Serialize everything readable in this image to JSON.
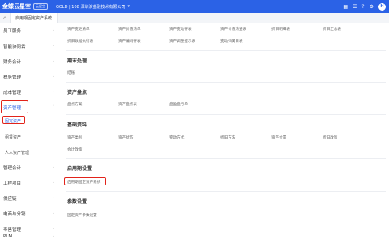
{
  "topbar": {
    "logo": "金蝶云星空",
    "logo_tag": "云星空",
    "org": "GOLD | 108 深圳演金融技术有限公司",
    "user_initial": "H"
  },
  "tabs": {
    "home_icon": "home-icon",
    "active": "启用期固定资产系统"
  },
  "sidebar": {
    "items": [
      {
        "label": "员工服务"
      },
      {
        "label": "智能协同云"
      },
      {
        "label": "财务会计"
      },
      {
        "label": "税务管理"
      },
      {
        "label": "成本管理"
      },
      {
        "label": "资产管理"
      },
      {
        "label": "固定资产"
      },
      {
        "label": "租赁资产"
      },
      {
        "label": "人人资产管理"
      },
      {
        "label": "管理会计"
      },
      {
        "label": "工程项目"
      },
      {
        "label": "供应链"
      },
      {
        "label": "电商与分销"
      },
      {
        "label": "零售管理"
      },
      {
        "label": "PLM"
      }
    ]
  },
  "main": {
    "top_links_row1": [
      "资产变更清单",
      "资产价值清单",
      "资产变动存表",
      "资产价值清查表",
      "折旧明细表",
      "折旧汇总表"
    ],
    "top_links_row2": [
      "折旧数据执行表",
      "资产编码存表",
      "资产调整提示表",
      "变动归属日表"
    ],
    "sections": [
      {
        "title": "期末处理",
        "links": [
          "结账"
        ]
      },
      {
        "title": "资产盘点",
        "links": [
          "盘点方案",
          "资产盘点表",
          "盘盈盘亏单"
        ]
      },
      {
        "title": "基础资料",
        "links": [
          "资产类别",
          "资产状态",
          "变动方式",
          "折旧方法",
          "资产位置",
          "折旧政策",
          "会计政策"
        ]
      },
      {
        "title": "启用期设置",
        "links": [
          "启用期固定资产系统"
        ]
      },
      {
        "title": "参数设置",
        "links": [
          "固定资产参数设置"
        ]
      }
    ]
  }
}
